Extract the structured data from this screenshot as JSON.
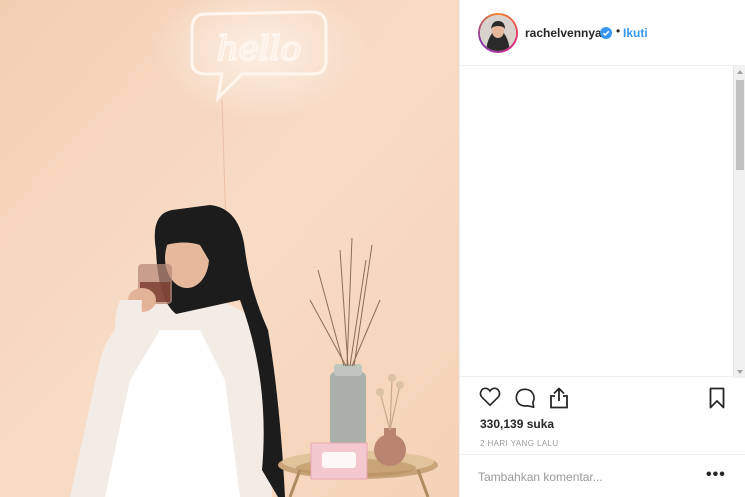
{
  "post": {
    "image_alt": "woman in hijab drinking tea beside a hello neon sign",
    "neon_text": "hello"
  },
  "header": {
    "username": "rachelvennya",
    "verified": true,
    "separator": "•",
    "follow_label": "Ikuti"
  },
  "actions": {
    "icons": [
      "heart-icon",
      "comment-icon",
      "share-icon",
      "bookmark-icon"
    ],
    "likes": "330,139 suka",
    "timestamp": "2 HARI YANG LALU"
  },
  "comment": {
    "placeholder": "Tambahkan komentar...",
    "more_label": "•••"
  },
  "colors": {
    "link": "#3897f0",
    "wall": "#f6d8bf",
    "border": "#efefef"
  }
}
